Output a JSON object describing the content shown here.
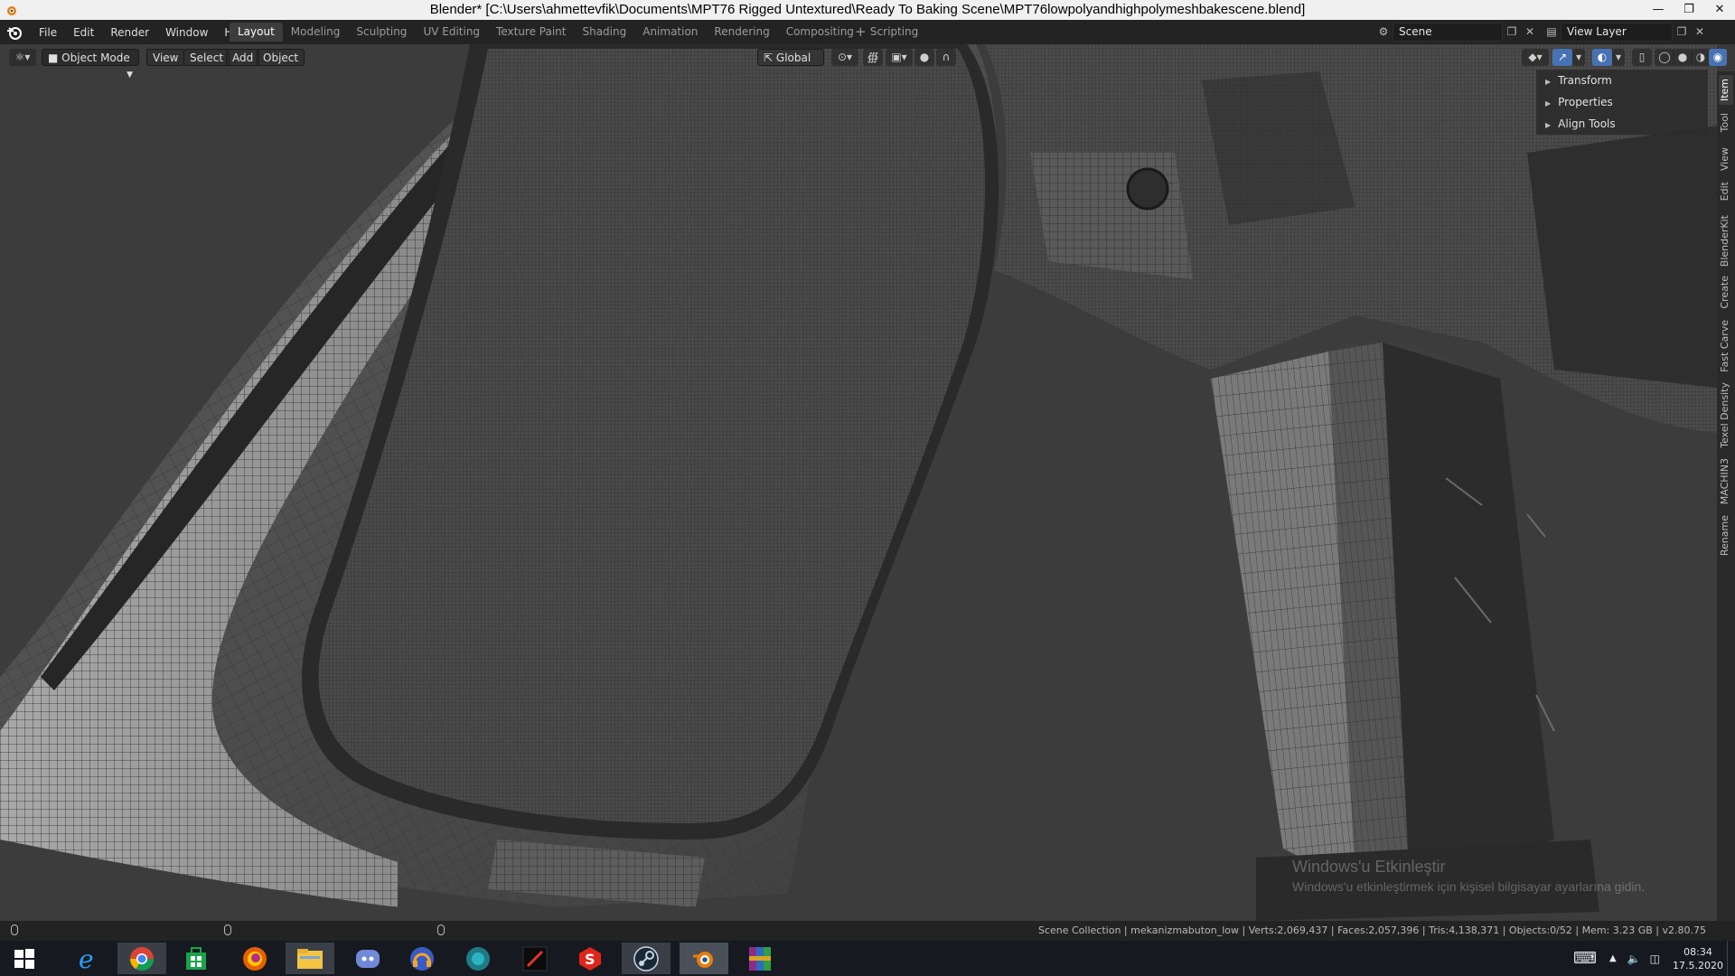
{
  "window": {
    "title": "Blender* [C:\\Users\\ahmettevfik\\Documents\\MPT76 Rigged Untextured\\Ready To Baking Scene\\MPT76lowpolyandhighpolymeshbakescene.blend]"
  },
  "topbar": {
    "menus": [
      "File",
      "Edit",
      "Render",
      "Window",
      "Help"
    ],
    "workspaces": [
      "Layout",
      "Modeling",
      "Sculpting",
      "UV Editing",
      "Texture Paint",
      "Shading",
      "Animation",
      "Rendering",
      "Compositing",
      "Scripting"
    ],
    "active_workspace": "Layout",
    "add_workspace": "+",
    "scene": "Scene",
    "view_layer": "View Layer"
  },
  "viewport_header": {
    "mode": "Object Mode",
    "menus": [
      "View",
      "Select",
      "Add",
      "Object"
    ],
    "orientation": "Global"
  },
  "npanel": {
    "sections": [
      "Transform",
      "Properties",
      "Align Tools"
    ]
  },
  "sidebar_tabs": [
    "Item",
    "Tool",
    "View",
    "Edit",
    "BlenderKit",
    "Create",
    "Fast Carve",
    "Texel Density",
    "MACHIN3",
    "Rename"
  ],
  "active_sidebar_tab": "Item",
  "watermark": {
    "line1": "Windows'u Etkinleştir",
    "line2": "Windows'u etkinleştirmek için kişisel bilgisayar ayarlarına gidin."
  },
  "statusbar": {
    "stats": "Scene Collection | mekanizmabuton_low | Verts:2,069,437 | Faces:2,057,396 | Tris:4,138,371 | Objects:0/52 | Mem: 3.23 GB | v2.80.75"
  },
  "taskbar": {
    "apps": [
      "windows-start",
      "internet-explorer",
      "chrome",
      "store",
      "firefox",
      "file-explorer",
      "discord",
      "headset-app",
      "teal-app",
      "black-app",
      "red-s-app",
      "steam",
      "blender",
      "winrar"
    ],
    "active_app": "blender",
    "time": "08:34",
    "date": "17.5.2020"
  },
  "colors": {
    "accent": "#4772b3",
    "viewport_bg": "#3c3c3c",
    "header_bg": "#232323"
  }
}
